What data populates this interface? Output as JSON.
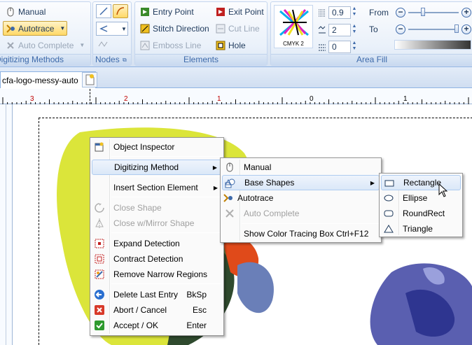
{
  "ribbon": {
    "digitizing_methods": {
      "manual": "Manual",
      "autotrace": "Autotrace",
      "auto_complete": "Auto Complete",
      "label": "Digitizing Methods"
    },
    "nodes": {
      "label": "Nodes"
    },
    "elements": {
      "entry_point": "Entry Point",
      "exit_point": "Exit Point",
      "stitch_direction": "Stitch Direction",
      "cut_line": "Cut Line",
      "emboss_line": "Emboss Line",
      "hole": "Hole",
      "label": "Elements"
    },
    "area_fill": {
      "pattern_label": "CMYK 2",
      "spin1": "0.9",
      "spin2": "2",
      "spin3": "0",
      "from": "From",
      "to": "To",
      "label": "Area Fill"
    }
  },
  "tab": {
    "name": "cfa-logo-messy-auto"
  },
  "ruler": {
    "ticks": [
      "3",
      "2",
      "1",
      "0",
      "1"
    ]
  },
  "context_menu": {
    "items": [
      {
        "label": "Object Inspector",
        "icon": "inspector-icon"
      },
      {
        "label": "Digitizing Method",
        "icon": "",
        "submenu": true
      },
      {
        "label": "Insert Section Element",
        "icon": "",
        "submenu": true
      },
      {
        "label": "Close Shape",
        "icon": "close-shape-icon",
        "disabled": true
      },
      {
        "label": "Close w/Mirror Shape",
        "icon": "mirror-shape-icon",
        "disabled": true
      },
      {
        "label": "Expand Detection",
        "icon": "expand-detection-icon"
      },
      {
        "label": "Contract Detection",
        "icon": "contract-detection-icon"
      },
      {
        "label": "Remove Narrow Regions",
        "icon": "remove-regions-icon"
      },
      {
        "label": "Delete Last Entry",
        "shortcut": "BkSp",
        "icon": "arrow-left-icon"
      },
      {
        "label": "Abort / Cancel",
        "shortcut": "Esc",
        "icon": "cancel-icon"
      },
      {
        "label": "Accept / OK",
        "shortcut": "Enter",
        "icon": "check-icon"
      }
    ]
  },
  "digitizing_submenu": {
    "items": [
      {
        "label": "Manual"
      },
      {
        "label": "Base Shapes"
      },
      {
        "label": "Autotrace"
      },
      {
        "label": "Auto Complete"
      },
      {
        "label": "Show Color Tracing Box Ctrl+F12"
      }
    ]
  },
  "shapes_submenu": {
    "items": [
      {
        "label": "Rectangle"
      },
      {
        "label": "Ellipse"
      },
      {
        "label": "RoundRect"
      },
      {
        "label": "Triangle"
      }
    ]
  },
  "colors": {
    "accent": "#3e6aaa",
    "highlight": "#dbe8f8"
  }
}
